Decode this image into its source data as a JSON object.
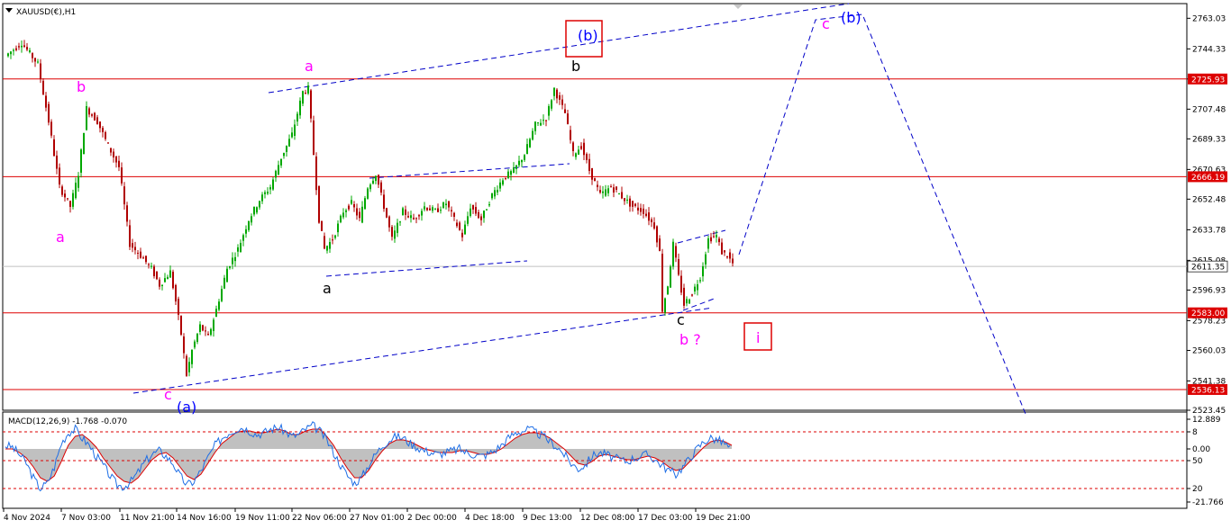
{
  "symbol_header": "XAUUSD(€),H1",
  "macd_header": "MACD(12,26,9) -1.768 -0.070",
  "colors": {
    "up_candle": "#00a800",
    "down_candle": "#b00000",
    "resistance_line": "#dd0000",
    "channel_line": "#0000c8",
    "wave_magenta": "#ff00ff",
    "wave_blue": "#0000ff",
    "wave_black": "#000000",
    "label_box": "#dd0000",
    "macd_hist": "#c0c0c0",
    "macd_signal": "#dd0000",
    "macd_line": "#1e6ee6"
  },
  "chart_data": [
    {
      "type": "candlestick",
      "title": "XAUUSD(€),H1",
      "ylim": [
        2523.45,
        2772.0
      ],
      "y_ticks": [
        "2763.03",
        "2744.33",
        "2725.93",
        "2707.48",
        "2689.33",
        "2670.63",
        "2652.48",
        "2633.78",
        "2615.08",
        "2596.93",
        "2578.23",
        "2560.03",
        "2541.38",
        "2523.45"
      ],
      "x_ticks": [
        "4 Nov 2024",
        "7 Nov 03:00",
        "11 Nov 21:00",
        "14 Nov 16:00",
        "19 Nov 11:00",
        "22 Nov 06:00",
        "27 Nov 01:00",
        "2 Dec 00:00",
        "4 Dec 18:00",
        "9 Dec 13:00",
        "12 Dec 08:00",
        "17 Dec 03:00",
        "19 Dec 21:00"
      ],
      "price_path": [
        {
          "i": 0,
          "p": 2740
        },
        {
          "i": 6,
          "p": 2748
        },
        {
          "i": 12,
          "p": 2735
        },
        {
          "i": 16,
          "p": 2700
        },
        {
          "i": 20,
          "p": 2660
        },
        {
          "i": 24,
          "p": 2648
        },
        {
          "i": 27,
          "p": 2668
        },
        {
          "i": 30,
          "p": 2708
        },
        {
          "i": 34,
          "p": 2700
        },
        {
          "i": 38,
          "p": 2685
        },
        {
          "i": 42,
          "p": 2672
        },
        {
          "i": 46,
          "p": 2625
        },
        {
          "i": 50,
          "p": 2618
        },
        {
          "i": 54,
          "p": 2610
        },
        {
          "i": 57,
          "p": 2600
        },
        {
          "i": 61,
          "p": 2608
        },
        {
          "i": 63,
          "p": 2590
        },
        {
          "i": 65,
          "p": 2570
        },
        {
          "i": 67,
          "p": 2545
        },
        {
          "i": 69,
          "p": 2560
        },
        {
          "i": 72,
          "p": 2575
        },
        {
          "i": 75,
          "p": 2568
        },
        {
          "i": 78,
          "p": 2585
        },
        {
          "i": 82,
          "p": 2610
        },
        {
          "i": 86,
          "p": 2622
        },
        {
          "i": 90,
          "p": 2640
        },
        {
          "i": 94,
          "p": 2652
        },
        {
          "i": 98,
          "p": 2660
        },
        {
          "i": 102,
          "p": 2678
        },
        {
          "i": 106,
          "p": 2692
        },
        {
          "i": 110,
          "p": 2718
        },
        {
          "i": 112,
          "p": 2720
        },
        {
          "i": 114,
          "p": 2680
        },
        {
          "i": 116,
          "p": 2640
        },
        {
          "i": 118,
          "p": 2622
        },
        {
          "i": 121,
          "p": 2628
        },
        {
          "i": 125,
          "p": 2645
        },
        {
          "i": 128,
          "p": 2650
        },
        {
          "i": 131,
          "p": 2640
        },
        {
          "i": 134,
          "p": 2660
        },
        {
          "i": 137,
          "p": 2668
        },
        {
          "i": 140,
          "p": 2648
        },
        {
          "i": 143,
          "p": 2628
        },
        {
          "i": 147,
          "p": 2645
        },
        {
          "i": 151,
          "p": 2640
        },
        {
          "i": 155,
          "p": 2648
        },
        {
          "i": 159,
          "p": 2645
        },
        {
          "i": 163,
          "p": 2650
        },
        {
          "i": 166,
          "p": 2640
        },
        {
          "i": 169,
          "p": 2630
        },
        {
          "i": 172,
          "p": 2648
        },
        {
          "i": 176,
          "p": 2640
        },
        {
          "i": 180,
          "p": 2655
        },
        {
          "i": 184,
          "p": 2665
        },
        {
          "i": 188,
          "p": 2670
        },
        {
          "i": 192,
          "p": 2680
        },
        {
          "i": 196,
          "p": 2698
        },
        {
          "i": 200,
          "p": 2702
        },
        {
          "i": 203,
          "p": 2720
        },
        {
          "i": 205,
          "p": 2712
        },
        {
          "i": 207,
          "p": 2705
        },
        {
          "i": 210,
          "p": 2680
        },
        {
          "i": 213,
          "p": 2685
        },
        {
          "i": 216,
          "p": 2670
        },
        {
          "i": 220,
          "p": 2655
        },
        {
          "i": 224,
          "p": 2660
        },
        {
          "i": 228,
          "p": 2654
        },
        {
          "i": 232,
          "p": 2648
        },
        {
          "i": 236,
          "p": 2645
        },
        {
          "i": 240,
          "p": 2636
        },
        {
          "i": 242,
          "p": 2620
        },
        {
          "i": 243,
          "p": 2585
        },
        {
          "i": 245,
          "p": 2600
        },
        {
          "i": 247,
          "p": 2625
        },
        {
          "i": 249,
          "p": 2605
        },
        {
          "i": 251,
          "p": 2588
        },
        {
          "i": 254,
          "p": 2595
        },
        {
          "i": 257,
          "p": 2605
        },
        {
          "i": 260,
          "p": 2628
        },
        {
          "i": 263,
          "p": 2630
        },
        {
          "i": 265,
          "p": 2620
        },
        {
          "i": 267,
          "p": 2618
        },
        {
          "i": 269,
          "p": 2613
        }
      ],
      "last_price": "2611.35",
      "horizontal_levels": [
        "2725.93",
        "2666.19",
        "2583.00",
        "2536.13"
      ],
      "price_level_labels": [
        "2725.93",
        "2666.19",
        "2611.35",
        "2583.00",
        "2536.13"
      ]
    },
    {
      "type": "area",
      "title": "MACD(12,26,9) -1.768 -0.070",
      "y_ticks": [
        "12.889",
        "8",
        "0.00",
        "50",
        "20",
        "-21.766"
      ],
      "series": [
        {
          "name": "macd",
          "values": [
            2,
            1,
            -3,
            -8,
            -16,
            -22,
            -19,
            -10,
            3,
            9,
            11,
            6,
            2,
            -4,
            -9,
            -15,
            -20,
            -21,
            -18,
            -13,
            -7,
            -3,
            -1,
            -4,
            -8,
            -15,
            -20,
            -18,
            -12,
            -5,
            2,
            6,
            9,
            11,
            12,
            10,
            8,
            9,
            11,
            12,
            10,
            7,
            8,
            11,
            13,
            10,
            5,
            -2,
            -9,
            -15,
            -19,
            -16,
            -9,
            -3,
            2,
            5,
            7,
            6,
            3,
            1,
            -1,
            -2,
            -3,
            -2,
            -1,
            0,
            -2,
            -3,
            -4,
            -3,
            -1,
            2,
            6,
            9,
            10,
            11,
            9,
            7,
            4,
            1,
            -3,
            -8,
            -11,
            -9,
            -4,
            -2,
            -3,
            -5,
            -6,
            -7,
            -5,
            -4,
            -3,
            -6,
            -9,
            -12,
            -14,
            -10,
            -5,
            0,
            4,
            6,
            5,
            3,
            -1
          ]
        },
        {
          "name": "signal",
          "values": [
            0,
            0,
            -2,
            -5,
            -10,
            -16,
            -18,
            -15,
            -7,
            2,
            7,
            8,
            5,
            1,
            -5,
            -10,
            -15,
            -18,
            -19,
            -16,
            -11,
            -6,
            -3,
            -2,
            -5,
            -10,
            -15,
            -17,
            -14,
            -8,
            -2,
            3,
            6,
            9,
            10,
            10,
            9,
            9,
            10,
            11,
            10,
            8,
            8,
            10,
            11,
            11,
            7,
            2,
            -5,
            -11,
            -16,
            -16,
            -12,
            -6,
            -1,
            3,
            5,
            5,
            4,
            2,
            0,
            -1,
            -2,
            -2,
            -2,
            -1,
            -1,
            -2,
            -3,
            -3,
            -2,
            0,
            3,
            6,
            8,
            9,
            9,
            8,
            6,
            3,
            0,
            -4,
            -8,
            -9,
            -7,
            -4,
            -3,
            -4,
            -5,
            -6,
            -6,
            -5,
            -4,
            -5,
            -7,
            -10,
            -12,
            -11,
            -7,
            -3,
            1,
            4,
            5,
            4,
            2
          ]
        }
      ]
    }
  ],
  "annotations": [
    {
      "text": "a",
      "color": "magenta"
    },
    {
      "text": "b",
      "color": "magenta"
    },
    {
      "text": "a",
      "color": "magenta"
    },
    {
      "text": "c",
      "color": "magenta"
    },
    {
      "text": "(a)",
      "color": "blue"
    },
    {
      "text": "a",
      "color": "black"
    },
    {
      "text": "b",
      "color": "black"
    },
    {
      "text": "(b)",
      "color": "blue",
      "boxed": true
    },
    {
      "text": "c",
      "color": "black"
    },
    {
      "text": "b ?",
      "color": "magenta"
    },
    {
      "text": "i",
      "color": "magenta",
      "boxed": true
    },
    {
      "text": "c",
      "color": "magenta"
    },
    {
      "text": "(b)",
      "color": "blue"
    }
  ]
}
